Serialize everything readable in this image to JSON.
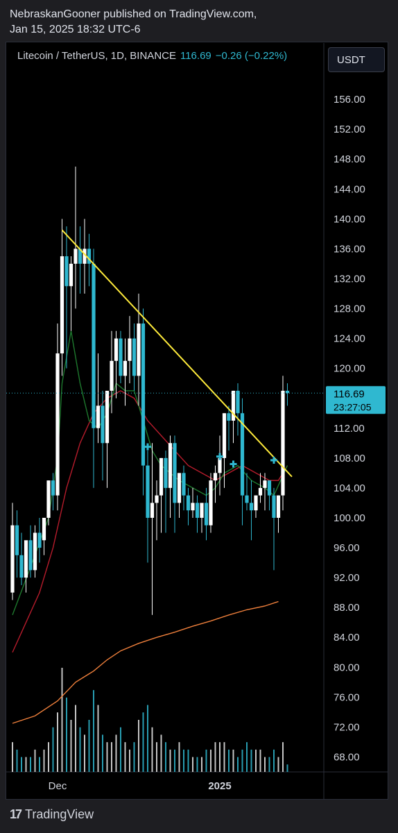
{
  "header": {
    "line1": "NebraskanGooner published on TradingView.com,",
    "line2": "Jan 15, 2025 18:32 UTC-6"
  },
  "legend": {
    "symbol": "Litecoin / TetherUS, 1D, BINANCE",
    "price": "116.69",
    "change": "−0.26 (−0.22%)"
  },
  "unit_button": "USDT",
  "price_tag": {
    "price": "116.69",
    "countdown": "23:27:05"
  },
  "footer": {
    "brand": "TradingView"
  },
  "colors": {
    "up": "#ffffff",
    "down": "#2fb8d0",
    "trendline": "#ffeb3b",
    "ema_fast": "#1e7a2e",
    "ema_mid": "#b71c2c",
    "ema_slow": "#f0803c",
    "signal": "#2fb8d0"
  },
  "chart_data": {
    "type": "candlestick",
    "symbol": "Litecoin / TetherUS",
    "interval": "1D",
    "exchange": "BINANCE",
    "ylim": [
      66,
      160
    ],
    "y_ticks": [
      "156.00",
      "152.00",
      "148.00",
      "144.00",
      "140.00",
      "136.00",
      "132.00",
      "128.00",
      "124.00",
      "120.00",
      "116.00",
      "112.00",
      "108.00",
      "104.00",
      "100.00",
      "96.00",
      "92.00",
      "88.00",
      "84.00",
      "80.00",
      "76.00",
      "72.00",
      "68.00"
    ],
    "x_ticks": [
      {
        "label": "Dec",
        "index": 10
      },
      {
        "label": "2025",
        "index": 46
      }
    ],
    "candles": [
      [
        90,
        102,
        89,
        99
      ],
      [
        99,
        101,
        92,
        95
      ],
      [
        95,
        98,
        91,
        92
      ],
      [
        92,
        96,
        90,
        97
      ],
      [
        97,
        99,
        92,
        93
      ],
      [
        93,
        99,
        92,
        98
      ],
      [
        98,
        100,
        94,
        96
      ],
      [
        97,
        100,
        95,
        100
      ],
      [
        100,
        105,
        99,
        105
      ],
      [
        105,
        106,
        101,
        103
      ],
      [
        103,
        126,
        101,
        122
      ],
      [
        122,
        140,
        119,
        135
      ],
      [
        135,
        139,
        120,
        131
      ],
      [
        131,
        135,
        125,
        134
      ],
      [
        134,
        147,
        128,
        136
      ],
      [
        136,
        139,
        130,
        134
      ],
      [
        134,
        140,
        130,
        136
      ],
      [
        136,
        138,
        131,
        134
      ],
      [
        134,
        136,
        104,
        112
      ],
      [
        112,
        122,
        110,
        115
      ],
      [
        115,
        117,
        105,
        110
      ],
      [
        110,
        116,
        104,
        117
      ],
      [
        117,
        125,
        114,
        121
      ],
      [
        121,
        125,
        116,
        124
      ],
      [
        124,
        125,
        118,
        119
      ],
      [
        119,
        124,
        115,
        121
      ],
      [
        121,
        127,
        118,
        124
      ],
      [
        124,
        126,
        117,
        119
      ],
      [
        119,
        130,
        115,
        126
      ],
      [
        126,
        128,
        103,
        107
      ],
      [
        107,
        109,
        94,
        100
      ],
      [
        100,
        110,
        87,
        102
      ],
      [
        102,
        105,
        97,
        103
      ],
      [
        103,
        108,
        98,
        108
      ],
      [
        108,
        109,
        98,
        104
      ],
      [
        104,
        111,
        100,
        110
      ],
      [
        110,
        111,
        98,
        102
      ],
      [
        102,
        105,
        100,
        106
      ],
      [
        106,
        107,
        101,
        103
      ],
      [
        103,
        104,
        99,
        101
      ],
      [
        101,
        104,
        100,
        102
      ],
      [
        102,
        103,
        98,
        100
      ],
      [
        100,
        101,
        98,
        102
      ],
      [
        102,
        104,
        97,
        99
      ],
      [
        99,
        106,
        98,
        105
      ],
      [
        105,
        107,
        102,
        106
      ],
      [
        106,
        111,
        103,
        108
      ],
      [
        108,
        114,
        104,
        114
      ],
      [
        114,
        115,
        109,
        113
      ],
      [
        113,
        117,
        110,
        117
      ],
      [
        117,
        118,
        111,
        114
      ],
      [
        114,
        116,
        99,
        103
      ],
      [
        103,
        106,
        101,
        102
      ],
      [
        102,
        105,
        97,
        101
      ],
      [
        101,
        103,
        100,
        103
      ],
      [
        103,
        106,
        102,
        104
      ],
      [
        104,
        106,
        101,
        105
      ],
      [
        105,
        105,
        101,
        103
      ],
      [
        103,
        104,
        93,
        100
      ],
      [
        100,
        103,
        98,
        103
      ],
      [
        103,
        119,
        101,
        117
      ],
      [
        117,
        118,
        115,
        116.69
      ]
    ],
    "volume": [
      4,
      3,
      2,
      2,
      2,
      3,
      2,
      3,
      4,
      6,
      8,
      14,
      10,
      7,
      9,
      6,
      5,
      7,
      11,
      9,
      5,
      4,
      4,
      5,
      6,
      4,
      3,
      4,
      7,
      8,
      9,
      6,
      4,
      5,
      4,
      3,
      3,
      4,
      3,
      3,
      2,
      2,
      2,
      3,
      3,
      4,
      4,
      4,
      3,
      3,
      2,
      3,
      4,
      3,
      3,
      3,
      2,
      2,
      3,
      2,
      4,
      1
    ],
    "ema_fast": [
      [
        0,
        87
      ],
      [
        5,
        95
      ],
      [
        8,
        100
      ],
      [
        10,
        108
      ],
      [
        11,
        118
      ],
      [
        13,
        125
      ],
      [
        15,
        118
      ],
      [
        17,
        113
      ],
      [
        19,
        112
      ],
      [
        21,
        114
      ],
      [
        23,
        118
      ],
      [
        25,
        117
      ],
      [
        27,
        117
      ],
      [
        29,
        113
      ],
      [
        31,
        109
      ],
      [
        33,
        107
      ],
      [
        35,
        106
      ],
      [
        37,
        105
      ],
      [
        40,
        104
      ],
      [
        43,
        103
      ],
      [
        45,
        104
      ],
      [
        47,
        106
      ],
      [
        50,
        107
      ],
      [
        53,
        105
      ],
      [
        56,
        104
      ],
      [
        58,
        103
      ],
      [
        61,
        107
      ]
    ],
    "ema_mid": [
      [
        0,
        82
      ],
      [
        3,
        86
      ],
      [
        6,
        90
      ],
      [
        9,
        96
      ],
      [
        12,
        104
      ],
      [
        15,
        110
      ],
      [
        18,
        114
      ],
      [
        21,
        116
      ],
      [
        24,
        117
      ],
      [
        27,
        116
      ],
      [
        30,
        113
      ],
      [
        33,
        111
      ],
      [
        36,
        109
      ],
      [
        39,
        107
      ],
      [
        42,
        106
      ],
      [
        45,
        105
      ],
      [
        48,
        106
      ],
      [
        51,
        107
      ],
      [
        54,
        106
      ],
      [
        57,
        105
      ],
      [
        59,
        105
      ],
      [
        61,
        107
      ]
    ],
    "ema_slow": [
      [
        0,
        72.5
      ],
      [
        5,
        73.5
      ],
      [
        10,
        75.5
      ],
      [
        14,
        78
      ],
      [
        18,
        79.5
      ],
      [
        21,
        81
      ],
      [
        24,
        82.2
      ],
      [
        28,
        83.2
      ],
      [
        32,
        84
      ],
      [
        36,
        84.7
      ],
      [
        40,
        85.5
      ],
      [
        44,
        86.2
      ],
      [
        48,
        87
      ],
      [
        52,
        87.7
      ],
      [
        56,
        88.2
      ],
      [
        59,
        88.8
      ]
    ],
    "trendline": [
      [
        11,
        138.5
      ],
      [
        62,
        105.5
      ]
    ],
    "signals": [
      [
        30,
        109.5
      ],
      [
        46,
        108.2
      ],
      [
        49,
        107.2
      ],
      [
        58,
        107.7
      ]
    ]
  }
}
